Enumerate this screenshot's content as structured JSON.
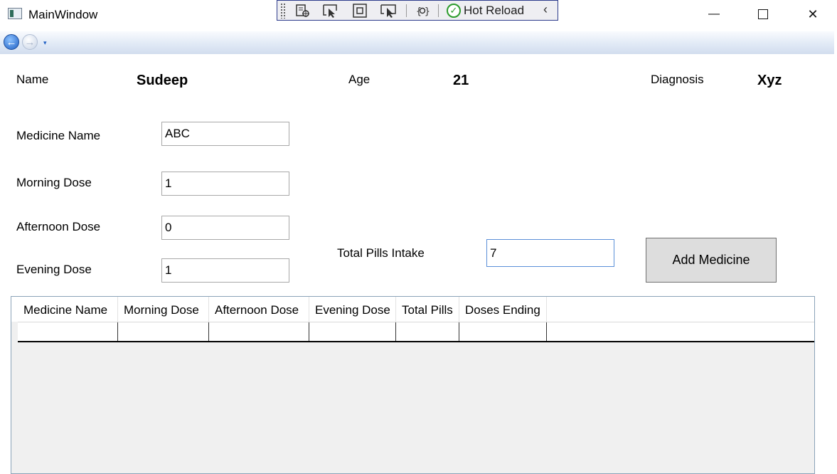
{
  "window": {
    "title": "MainWindow",
    "minimize_glyph": "—",
    "maximize_glyph": "☐",
    "close_glyph": "✕"
  },
  "hot_reload_toolbar": {
    "label": "Hot Reload",
    "icons": [
      "grip-icon",
      "live-visual-tree-icon",
      "select-element-icon",
      "display-adorners-icon",
      "track-focus-icon",
      "binding-failures-icon",
      "hot-reload-check-icon",
      "collapse-chevron-icon"
    ]
  },
  "navigation": {
    "back_glyph": "←",
    "forward_glyph": "→",
    "dropdown_glyph": "▾"
  },
  "patient": {
    "name_label": "Name",
    "name_value": "Sudeep",
    "age_label": "Age",
    "age_value": "21",
    "diagnosis_label": "Diagnosis",
    "diagnosis_value": "Xyz"
  },
  "form": {
    "medicine_name_label": "Medicine Name",
    "medicine_name_value": "ABC",
    "morning_dose_label": "Morning Dose",
    "morning_dose_value": "1",
    "afternoon_dose_label": "Afternoon Dose",
    "afternoon_dose_value": "0",
    "evening_dose_label": "Evening Dose",
    "evening_dose_value": "1",
    "total_pills_label": "Total Pills Intake",
    "total_pills_value": "7",
    "add_button_label": "Add Medicine"
  },
  "grid": {
    "columns": [
      "Medicine Name",
      "Morning Dose",
      "Afternoon Dose",
      "Evening Dose",
      "Total Pills",
      "Doses Ending"
    ],
    "rows": []
  },
  "colors": {
    "hot_reload_border": "#2c3b8c",
    "hot_reload_check": "#2b9b2b",
    "nav_back": "#1f5fc4",
    "focus_border": "#5a8fd8",
    "button_bg": "#dddddd"
  }
}
